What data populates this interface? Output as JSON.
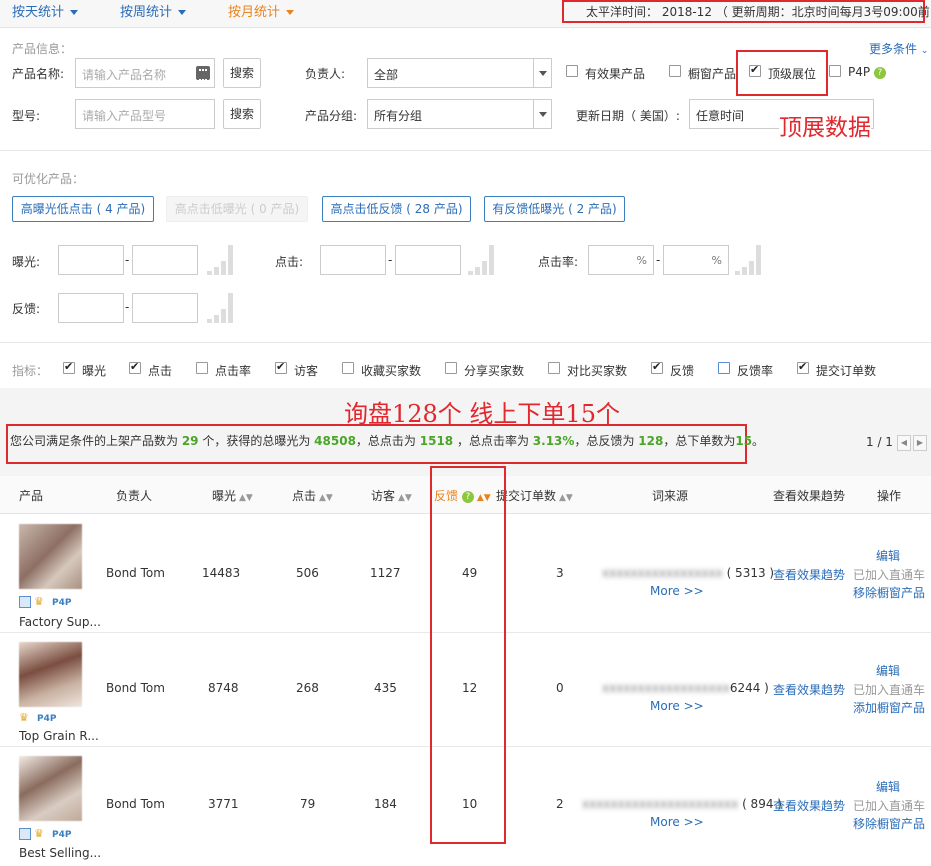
{
  "tabs": [
    {
      "label": "按天统计"
    },
    {
      "label": "按周统计"
    },
    {
      "label": "按月统计"
    }
  ],
  "timezone_text": "太平洋时间： 2018-12 （ 更新周期：北京时间每月3号09:00前 ）",
  "filters": {
    "section_label": "产品信息：",
    "more_conditions": "更多条件",
    "product_name_label": "产品名称:",
    "product_name_placeholder": "请输入产品名称",
    "model_label": "型号:",
    "model_placeholder": "请输入产品型号",
    "search_label": "搜索",
    "owner_label": "负责人:",
    "owner_value": "全部",
    "group_label": "产品分组:",
    "group_value": "所有分组",
    "update_date_label": "更新日期（ 美国）:",
    "update_date_value": "任意时间",
    "checks": [
      {
        "label": "有效果产品",
        "checked": false
      },
      {
        "label": "橱窗产品",
        "checked": false
      },
      {
        "label": "顶级展位",
        "checked": true
      },
      {
        "label": "P4P",
        "checked": false
      }
    ]
  },
  "annotation_top": "顶展数据",
  "optimize": {
    "section_label": "可优化产品：",
    "buttons": [
      {
        "label": "高曝光低点击 ( 4 产品)",
        "disabled": false
      },
      {
        "label": "高点击低曝光 ( 0 产品)",
        "disabled": true
      },
      {
        "label": "高点击低反馈 ( 28 产品)",
        "disabled": false
      },
      {
        "label": "有反馈低曝光 ( 2 产品)",
        "disabled": false
      }
    ],
    "exposure_label": "曝光:",
    "click_label": "点击:",
    "ctr_label": "点击率:",
    "feedback_label": "反馈:",
    "percent": "%",
    "dash": "-"
  },
  "metrics": {
    "label": "指标：",
    "items": [
      {
        "label": "曝光",
        "checked": true
      },
      {
        "label": "点击",
        "checked": true
      },
      {
        "label": "点击率",
        "checked": false
      },
      {
        "label": "访客",
        "checked": true
      },
      {
        "label": "收藏买家数",
        "checked": false
      },
      {
        "label": "分享买家数",
        "checked": false
      },
      {
        "label": "对比买家数",
        "checked": false
      },
      {
        "label": "反馈",
        "checked": true
      },
      {
        "label": "反馈率",
        "checked": false
      },
      {
        "label": "提交订单数",
        "checked": true
      }
    ]
  },
  "annotation_mid": "询盘128个  线上下单15个",
  "summary": {
    "t1": "您公司满足条件的上架产品数为 ",
    "products": "29",
    "t2": " 个，获得的总曝光为 ",
    "exposure": "48508",
    "t3": "，总点击为 ",
    "clicks": "1518",
    "t4": " ，总点击率为 ",
    "ctr": "3.13%",
    "t5": "，总反馈为 ",
    "feedback": "128",
    "t6": "，总下单数为",
    "orders": "15",
    "t7": "。"
  },
  "pager": "1 / 1",
  "table": {
    "headers": [
      "产品",
      "负责人",
      "曝光",
      "点击",
      "访客",
      "反馈",
      "提交订单数",
      "词来源",
      "查看效果趋势",
      "操作"
    ],
    "rows": [
      {
        "name": "Factory Sup...",
        "owner": "Bond Tom",
        "exposure": "14483",
        "clicks": "506",
        "visitors": "1127",
        "feedback": "49",
        "orders": "3",
        "source_count": "( 5313 )",
        "more": "More >>",
        "trend": "查看效果趋势",
        "op1": "编辑",
        "op2": "已加入直通车",
        "op3": "移除橱窗产品",
        "badges": "grid-crown-p4p"
      },
      {
        "name": "Top Grain R...",
        "owner": "Bond Tom",
        "exposure": "8748",
        "clicks": "268",
        "visitors": "435",
        "feedback": "12",
        "orders": "0",
        "source_count": "6244 )",
        "more": "More >>",
        "trend": "查看效果趋势",
        "op1": "编辑",
        "op2": "已加入直通车",
        "op3": "添加橱窗产品",
        "badges": "crown-p4p"
      },
      {
        "name": "Best Selling...",
        "owner": "Bond Tom",
        "exposure": "3771",
        "clicks": "79",
        "visitors": "184",
        "feedback": "10",
        "orders": "2",
        "source_count": "( 894 )",
        "more": "More >>",
        "trend": "查看效果趋势",
        "op1": "编辑",
        "op2": "已加入直通车",
        "op3": "移除橱窗产品",
        "badges": "grid-crown-p4p"
      }
    ]
  },
  "badge_p4p": "P4P",
  "colors": {
    "link": "#2a6db8",
    "active_tab": "#e8841f",
    "annotation": "#e0282e",
    "highlight_number": "#4aa528"
  }
}
